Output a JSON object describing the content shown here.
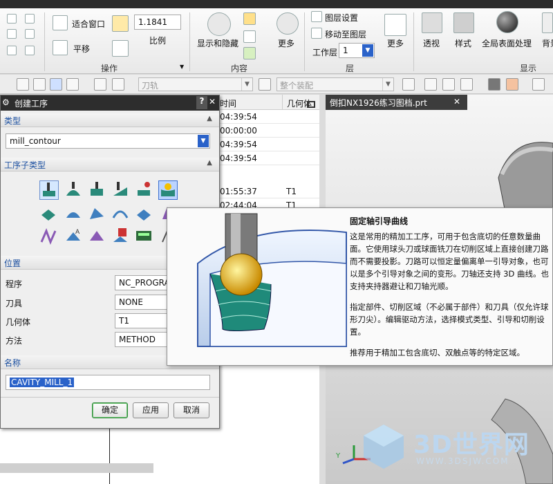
{
  "ribbon": {
    "fit_window": "适合窗口",
    "pan": "平移",
    "scale_value": "1.1841",
    "scale_label": "比例",
    "group_operation": "操作",
    "show_hide": "显示和隐藏",
    "more1": "更多",
    "group_content": "内容",
    "layer_settings": "图层设置",
    "move_to_layer": "移动至图层",
    "work_layer_label": "工作层",
    "work_layer_value": "1",
    "group_layer": "层",
    "more2": "更多",
    "perspective": "透视",
    "style": "样式",
    "global_shading": "全局表面处理",
    "background": "背景",
    "group_display": "显示"
  },
  "toolbar2": {
    "tool_axis_combo": "刀轨",
    "assembly_combo": "整个装配"
  },
  "navigator": {
    "col_time": "时间",
    "col_geometry": "几何体",
    "rows": [
      {
        "time": "04:39:54",
        "geom": ""
      },
      {
        "time": "00:00:00",
        "geom": ""
      },
      {
        "time": "04:39:54",
        "geom": ""
      },
      {
        "time": "04:39:54",
        "geom": ""
      },
      {
        "time": "01:55:37",
        "geom": "T1"
      },
      {
        "time": "02:44:04",
        "geom": "T1"
      }
    ]
  },
  "viewport": {
    "tab_title": "倒扣NX1926练习图档.prt"
  },
  "dialog": {
    "title": "创建工序",
    "type_section": "类型",
    "type_value": "mill_contour",
    "subtype_section": "工序子类型",
    "position_section": "位置",
    "program_label": "程序",
    "program_value": "NC_PROGRAM",
    "tool_label": "刀具",
    "tool_value": "NONE",
    "geometry_label": "几何体",
    "geometry_value": "T1",
    "method_label": "方法",
    "method_value": "METHOD",
    "name_section": "名称",
    "name_value": "CAVITY_MILL_1",
    "ok": "确定",
    "apply": "应用",
    "cancel": "取消",
    "help": "?",
    "close": "✕"
  },
  "tooltip": {
    "title": "固定轴引导曲线",
    "p1_l1": "这是常用的精加工工序，可用于包含底切的任意数量曲",
    "p1_l2": "面。它使用球头刀或球面铣刀在切削区域上直接创建刀路",
    "p1_l3": "而不需要投影。刀路可以恒定量偏离单一引导对象，也可",
    "p1_l4": "以是多个引导对象之间的变形。刀轴还支持 3D 曲线。也",
    "p1_l5": "支持夹持器避让和刀轴光顺。",
    "p2_l1": "指定部件、切削区域（不必属于部件）和刀具（仅允许球",
    "p2_l2": "形刀尖）。编辑驱动方法，选择模式类型、引导和切削设",
    "p2_l3": "置。",
    "p3_l1": "推荐用于精加工包含底切、双触点等的特定区域。"
  },
  "watermark": {
    "brand": "3D世界网",
    "url": "WWW.3DSJW.COM"
  },
  "colors": {
    "accent": "#1b4fa0",
    "selected_text_bg": "#2a62c9",
    "ok_button": "#2e9a3a"
  }
}
